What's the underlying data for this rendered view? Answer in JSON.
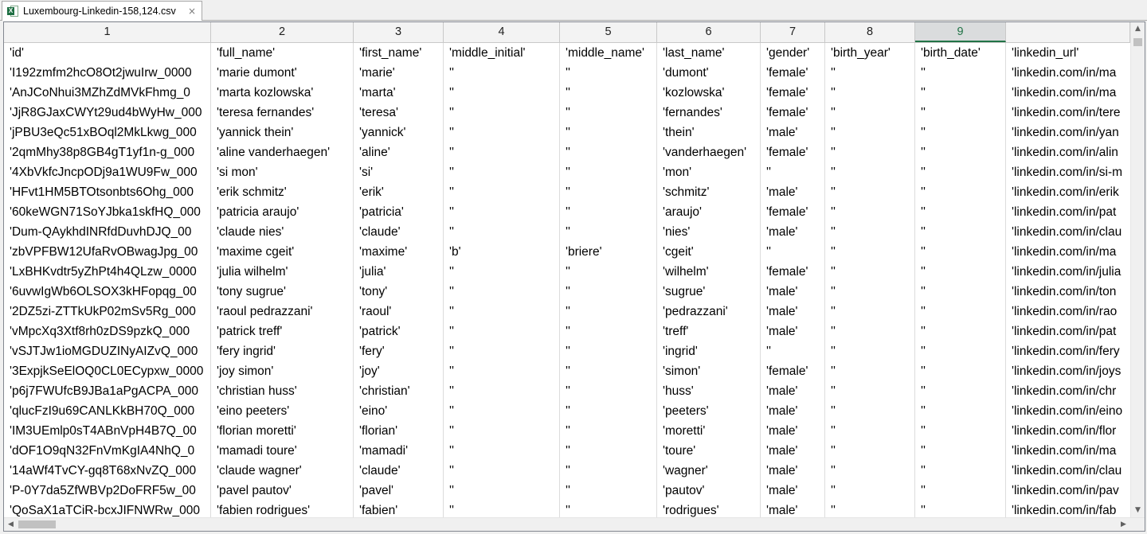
{
  "tab": {
    "title": "Luxembourg-Linkedin-158,124.csv",
    "icon": "excel-file-icon",
    "close_glyph": "×"
  },
  "colors": {
    "accent": "#217346",
    "selected_header_bg": "#dadcdd",
    "grid_line": "#dcdcdc"
  },
  "columns": [
    "1",
    "2",
    "3",
    "4",
    "5",
    "6",
    "7",
    "8",
    "9",
    ""
  ],
  "selected_column": "9",
  "rows": [
    [
      "'id'",
      "'full_name'",
      "'first_name'",
      "'middle_initial'",
      "'middle_name'",
      "'last_name'",
      "'gender'",
      "'birth_year'",
      "'birth_date'",
      "'linkedin_url'"
    ],
    [
      "'I192zmfm2hcO8Ot2jwuIrw_0000",
      "'marie dumont'",
      "'marie'",
      "''",
      "''",
      "'dumont'",
      "'female'",
      "''",
      "''",
      "'linkedin.com/in/ma"
    ],
    [
      "'AnJCoNhui3MZhZdMVkFhmg_0",
      "'marta kozlowska'",
      "'marta'",
      "''",
      "''",
      "'kozlowska'",
      "'female'",
      "''",
      "''",
      "'linkedin.com/in/ma"
    ],
    [
      "'JjR8GJaxCWYt29ud4bWyHw_000",
      "'teresa fernandes'",
      "'teresa'",
      "''",
      "''",
      "'fernandes'",
      "'female'",
      "''",
      "''",
      "'linkedin.com/in/tere"
    ],
    [
      "'jPBU3eQc51xBOql2MkLkwg_000",
      "'yannick thein'",
      "'yannick'",
      "''",
      "''",
      "'thein'",
      "'male'",
      "''",
      "''",
      "'linkedin.com/in/yan"
    ],
    [
      "'2qmMhy38p8GB4gT1yf1n-g_000",
      "'aline vanderhaegen'",
      "'aline'",
      "''",
      "''",
      "'vanderhaegen'",
      "'female'",
      "''",
      "''",
      "'linkedin.com/in/alin"
    ],
    [
      "'4XbVkfcJncpODj9a1WU9Fw_000",
      "'si mon'",
      "'si'",
      "''",
      "''",
      "'mon'",
      "''",
      "''",
      "''",
      "'linkedin.com/in/si-m"
    ],
    [
      "'HFvt1HM5BTOtsonbts6Ohg_000",
      "'erik schmitz'",
      "'erik'",
      "''",
      "''",
      "'schmitz'",
      "'male'",
      "''",
      "''",
      "'linkedin.com/in/erik"
    ],
    [
      "'60keWGN71SoYJbka1skfHQ_000",
      "'patricia araujo'",
      "'patricia'",
      "''",
      "''",
      "'araujo'",
      "'female'",
      "''",
      "''",
      "'linkedin.com/in/pat"
    ],
    [
      "'Dum-QAykhdINRfdDuvhDJQ_00",
      "'claude nies'",
      "'claude'",
      "''",
      "''",
      "'nies'",
      "'male'",
      "''",
      "''",
      "'linkedin.com/in/clau"
    ],
    [
      "'zbVPFBW12UfaRvOBwagJpg_00",
      "'maxime cgeit'",
      "'maxime'",
      "'b'",
      "'briere'",
      "'cgeit'",
      "''",
      "''",
      "''",
      "'linkedin.com/in/ma"
    ],
    [
      "'LxBHKvdtr5yZhPt4h4QLzw_0000",
      "'julia wilhelm'",
      "'julia'",
      "''",
      "''",
      "'wilhelm'",
      "'female'",
      "''",
      "''",
      "'linkedin.com/in/julia"
    ],
    [
      "'6uvwIgWb6OLSOX3kHFopqg_00",
      "'tony sugrue'",
      "'tony'",
      "''",
      "''",
      "'sugrue'",
      "'male'",
      "''",
      "''",
      "'linkedin.com/in/ton"
    ],
    [
      "'2DZ5zi-ZTTkUkP02mSv5Rg_000",
      "'raoul pedrazzani'",
      "'raoul'",
      "''",
      "''",
      "'pedrazzani'",
      "'male'",
      "''",
      "''",
      "'linkedin.com/in/rao"
    ],
    [
      "'vMpcXq3Xtf8rh0zDS9pzkQ_000",
      "'patrick treff'",
      "'patrick'",
      "''",
      "''",
      "'treff'",
      "'male'",
      "''",
      "''",
      "'linkedin.com/in/pat"
    ],
    [
      "'vSJTJw1ioMGDUZINyAIZvQ_000",
      "'fery ingrid'",
      "'fery'",
      "''",
      "''",
      "'ingrid'",
      "''",
      "''",
      "''",
      "'linkedin.com/in/fery"
    ],
    [
      "'3ExpjkSeElOQ0CL0ECypxw_0000",
      "'joy simon'",
      "'joy'",
      "''",
      "''",
      "'simon'",
      "'female'",
      "''",
      "''",
      "'linkedin.com/in/joys"
    ],
    [
      "'p6j7FWUfcB9JBa1aPgACPA_000",
      "'christian huss'",
      "'christian'",
      "''",
      "''",
      "'huss'",
      "'male'",
      "''",
      "''",
      "'linkedin.com/in/chr"
    ],
    [
      "'qlucFzI9u69CANLKkBH70Q_000",
      "'eino peeters'",
      "'eino'",
      "''",
      "''",
      "'peeters'",
      "'male'",
      "''",
      "''",
      "'linkedin.com/in/eino"
    ],
    [
      "'IM3UEmlp0sT4ABnVpH4B7Q_00",
      "'florian moretti'",
      "'florian'",
      "''",
      "''",
      "'moretti'",
      "'male'",
      "''",
      "''",
      "'linkedin.com/in/flor"
    ],
    [
      "'dOF1O9qN32FnVmKgIA4NhQ_0",
      "'mamadi toure'",
      "'mamadi'",
      "''",
      "''",
      "'toure'",
      "'male'",
      "''",
      "''",
      "'linkedin.com/in/ma"
    ],
    [
      "'14aWf4TvCY-gq8T68xNvZQ_000",
      "'claude wagner'",
      "'claude'",
      "''",
      "''",
      "'wagner'",
      "'male'",
      "''",
      "''",
      "'linkedin.com/in/clau"
    ],
    [
      "'P-0Y7da5ZfWBVp2DoFRF5w_00",
      "'pavel pautov'",
      "'pavel'",
      "''",
      "''",
      "'pautov'",
      "'male'",
      "''",
      "''",
      "'linkedin.com/in/pav"
    ],
    [
      "'QoSaX1aTCiR-bcxJIFNWRw_000",
      "'fabien rodrigues'",
      "'fabien'",
      "''",
      "''",
      "'rodrigues'",
      "'male'",
      "''",
      "''",
      "'linkedin.com/in/fab"
    ]
  ],
  "scrollbars": {
    "up_glyph": "▲",
    "down_glyph": "▼",
    "left_glyph": "◀",
    "right_glyph": "▶"
  }
}
